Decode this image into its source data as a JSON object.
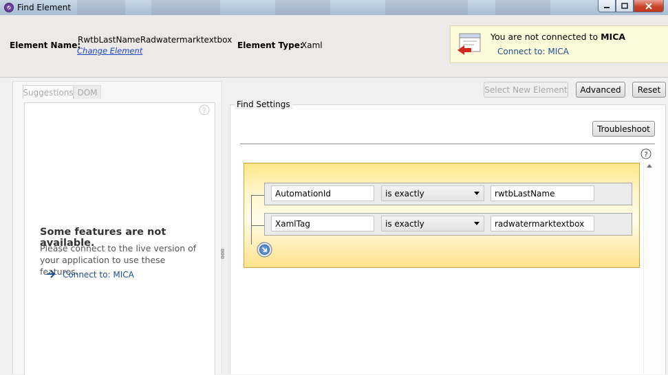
{
  "window": {
    "title": "Find Element",
    "minimize_icon": "minimize-icon",
    "maximize_icon": "maximize-icon",
    "close_icon": "close-icon"
  },
  "header": {
    "element_name_label": "Element Name:",
    "element_name_value": "RwtbLastNameRadwatermarktextbox",
    "change_element_link": "Change Element",
    "element_type_label": "Element Type:",
    "element_type_value": "Xaml"
  },
  "mica_notice": {
    "message_prefix": "You are not connected to ",
    "message_bold": "MICA",
    "connect_link": "Connect to: MICA",
    "icon": "disconnected-window-icon"
  },
  "left_panel": {
    "tabs": [
      {
        "label": "Suggestions"
      },
      {
        "label": "DOM"
      }
    ],
    "unavailable_title": "Some features are not available.",
    "unavailable_desc": "Please connect to the live version of your application to use these features.",
    "connect_link": "Connect to: MICA"
  },
  "toolbar": {
    "select_new_element": "Select New Element",
    "advanced": "Advanced",
    "reset": "Reset"
  },
  "find_settings": {
    "legend": "Find Settings",
    "troubleshoot": "Troubleshoot",
    "rows": [
      {
        "attribute": "AutomationId",
        "operator": "is exactly",
        "value": "rwtbLastName"
      },
      {
        "attribute": "XamlTag",
        "operator": "is exactly",
        "value": "radwatermarktextbox"
      }
    ]
  },
  "colors": {
    "accent_link": "#1a46c6",
    "notice_bg": "#fdfbd9",
    "filter_group_border": "#d4a23d"
  }
}
